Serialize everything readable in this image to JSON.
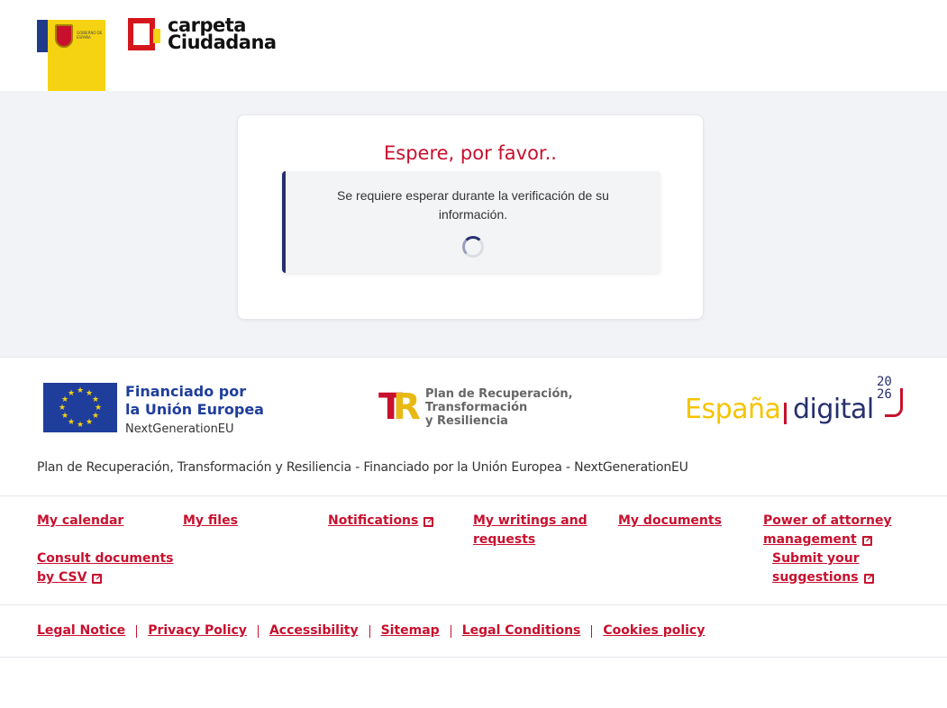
{
  "header": {
    "gov_logo_text": "GOBIERNO DE ESPAÑA",
    "brand_line1": "carpeta",
    "brand_line2": "Ciudadana"
  },
  "card": {
    "title": "Espere, por favor..",
    "message": "Se requiere esperar durante la verificación de su información."
  },
  "funding": {
    "eu_line1": "Financiado por",
    "eu_line2": "la Unión Europea",
    "eu_line3": "NextGenerationEU",
    "prtr_line1": "Plan de Recuperación,",
    "prtr_line2": "Transformación",
    "prtr_line3": "y Resiliencia",
    "ed_espana": "España",
    "ed_digital": "digital",
    "ed_year1": "20",
    "ed_year2": "26",
    "caption": "Plan de Recuperación, Transformación y Resiliencia - Financiado por la Unión Europea - NextGenerationEU"
  },
  "nav": {
    "my_calendar": "My calendar",
    "my_files": "My files",
    "notifications": "Notifications",
    "my_writings_1": "My writings and",
    "my_writings_2": "requests",
    "my_documents": "My documents",
    "power_1": "Power of attorney",
    "power_2": "management",
    "csv_1": "Consult documents",
    "csv_2": "by CSV",
    "suggest_1": "Submit your",
    "suggest_2": "suggestions"
  },
  "legal": {
    "legal_notice": "Legal Notice",
    "privacy_policy": "Privacy Policy",
    "accessibility": "Accessibility",
    "sitemap": "Sitemap",
    "legal_conditions": "Legal Conditions",
    "cookies_policy": "Cookies policy"
  },
  "colors": {
    "accent_red": "#c8102e",
    "navy": "#262f6e",
    "eu_blue": "#1f3e9c",
    "yellow": "#f5d312"
  }
}
